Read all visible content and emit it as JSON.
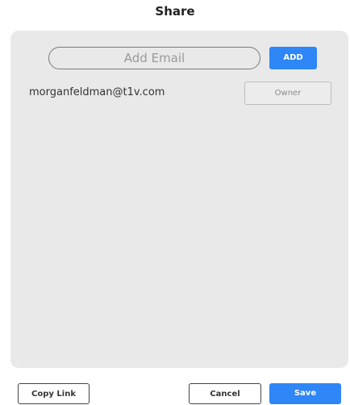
{
  "dialog": {
    "title": "Share"
  },
  "add_email": {
    "placeholder": "Add Email",
    "value": "",
    "add_label": "ADD"
  },
  "members": [
    {
      "email": "morganfeldman@t1v.com",
      "role": "Owner"
    }
  ],
  "footer": {
    "copy_link_label": "Copy Link",
    "cancel_label": "Cancel",
    "save_label": "Save"
  },
  "colors": {
    "accent": "#2f86f6",
    "panel_background": "#e9e9e9"
  }
}
